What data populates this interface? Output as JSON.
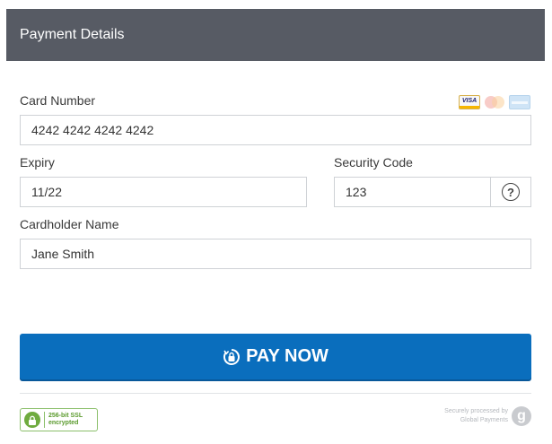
{
  "header": {
    "title": "Payment Details"
  },
  "card_number": {
    "label": "Card Number",
    "value": "4242 4242 4242 4242"
  },
  "card_brands": [
    {
      "name": "visa-logo",
      "text": "VISA"
    },
    {
      "name": "mastercard-logo"
    },
    {
      "name": "amex-logo"
    }
  ],
  "expiry": {
    "label": "Expiry",
    "value": "11/22"
  },
  "security_code": {
    "label": "Security Code",
    "value": "123",
    "help_symbol": "?"
  },
  "cardholder": {
    "label": "Cardholder Name",
    "value": "Jane Smith"
  },
  "pay_button": {
    "label": "PAY NOW"
  },
  "ssl_badge": {
    "line1": "256-bit SSL",
    "line2": "encrypted"
  },
  "secure_note": {
    "line1": "Securely processed by",
    "line2": "Global Payments",
    "logo_letter": "g"
  },
  "colors": {
    "header_bg": "#575b64",
    "button_bg": "#0a6ebd",
    "ssl_green": "#6fab3f"
  }
}
